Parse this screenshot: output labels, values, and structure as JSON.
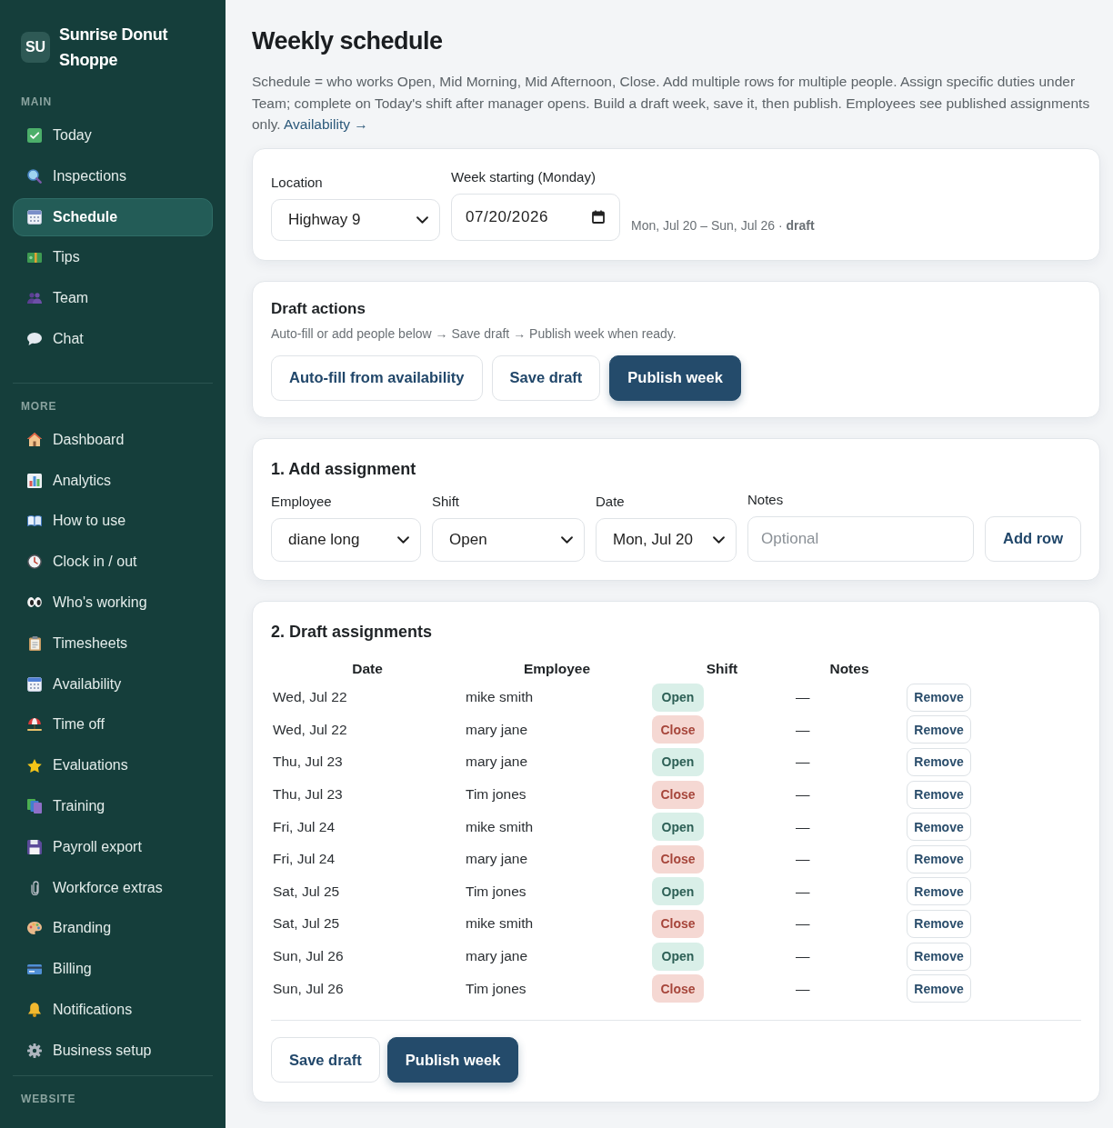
{
  "sidebar": {
    "logo": "SU",
    "brand": "Sunrise Donut Shoppe",
    "sections": [
      {
        "label": "MAIN",
        "items": [
          {
            "label": "Today",
            "selected": false
          },
          {
            "label": "Inspections",
            "selected": false
          },
          {
            "label": "Schedule",
            "selected": true
          },
          {
            "label": "Tips",
            "selected": false
          },
          {
            "label": "Team",
            "selected": false
          },
          {
            "label": "Chat",
            "selected": false
          }
        ]
      },
      {
        "label": "MORE",
        "items": [
          {
            "label": "Dashboard",
            "selected": false
          },
          {
            "label": "Analytics",
            "selected": false
          },
          {
            "label": "How to use",
            "selected": false
          },
          {
            "label": "Clock in / out",
            "selected": false
          },
          {
            "label": "Who's working",
            "selected": false
          },
          {
            "label": "Timesheets",
            "selected": false
          },
          {
            "label": "Availability",
            "selected": false
          },
          {
            "label": "Time off",
            "selected": false
          },
          {
            "label": "Evaluations",
            "selected": false
          },
          {
            "label": "Training",
            "selected": false
          },
          {
            "label": "Payroll export",
            "selected": false
          },
          {
            "label": "Workforce extras",
            "selected": false
          },
          {
            "label": "Branding",
            "selected": false
          },
          {
            "label": "Billing",
            "selected": false
          },
          {
            "label": "Notifications",
            "selected": false
          },
          {
            "label": "Business setup",
            "selected": false
          }
        ]
      },
      {
        "label": "WEBSITE"
      }
    ]
  },
  "page": {
    "title": "Weekly schedule",
    "description": "Schedule = who works Open, Mid Morning, Mid Afternoon, Close. Add multiple rows for multiple people. Assign specific duties under Team; complete on Today's shift after manager opens. Build a draft week, save it, then publish. Employees see published assignments only.",
    "link": "Availability →"
  },
  "week": {
    "location": {
      "label": "Location",
      "value": "Highway 9"
    },
    "week_start": {
      "label": "Week starting (Monday)",
      "value": "07/20/2026"
    },
    "summary": "Mon, Jul 20 – Sun, Jul 26 · **draft**"
  },
  "draft_actions": {
    "title": "Draft actions",
    "hint": "Auto-fill or add people below → Save draft → Publish week when ready.",
    "buttons": [
      {
        "label": "Auto-fill from availability",
        "kind": "secondary"
      },
      {
        "label": "Save draft",
        "kind": "secondary"
      },
      {
        "label": "Publish week",
        "kind": "primary"
      }
    ]
  },
  "add_assignment": {
    "title": "1. Add assignment",
    "fields": [
      {
        "label": "Employee",
        "kind": "select",
        "value": "diane long"
      },
      {
        "label": "Shift",
        "kind": "select",
        "value": "Open"
      },
      {
        "label": "Date",
        "kind": "select",
        "value": "Mon, Jul 20"
      },
      {
        "label": "Notes",
        "kind": "text",
        "placeholder": "Optional"
      }
    ],
    "button": "Add row"
  },
  "draft_assignments": {
    "title": "2. Draft assignments",
    "columns": [
      "Date",
      "Employee",
      "Shift",
      "Notes"
    ],
    "rows": [
      {
        "date": "Wed, Jul 22",
        "employee": "mike smith",
        "shift": "Open",
        "kind": "open",
        "notes": "—",
        "action": "Remove"
      },
      {
        "date": "Wed, Jul 22",
        "employee": "mary jane",
        "shift": "Close",
        "kind": "close",
        "notes": "—",
        "action": "Remove"
      },
      {
        "date": "Thu, Jul 23",
        "employee": "mary jane",
        "shift": "Open",
        "kind": "open",
        "notes": "—",
        "action": "Remove"
      },
      {
        "date": "Thu, Jul 23",
        "employee": "Tim jones",
        "shift": "Close",
        "kind": "close",
        "notes": "—",
        "action": "Remove"
      },
      {
        "date": "Fri, Jul 24",
        "employee": "mike smith",
        "shift": "Open",
        "kind": "open",
        "notes": "—",
        "action": "Remove"
      },
      {
        "date": "Fri, Jul 24",
        "employee": "mary jane",
        "shift": "Close",
        "kind": "close",
        "notes": "—",
        "action": "Remove"
      },
      {
        "date": "Sat, Jul 25",
        "employee": "Tim jones",
        "shift": "Open",
        "kind": "open",
        "notes": "—",
        "action": "Remove"
      },
      {
        "date": "Sat, Jul 25",
        "employee": "mike smith",
        "shift": "Close",
        "kind": "close",
        "notes": "—",
        "action": "Remove"
      },
      {
        "date": "Sun, Jul 26",
        "employee": "mary jane",
        "shift": "Open",
        "kind": "open",
        "notes": "—",
        "action": "Remove"
      },
      {
        "date": "Sun, Jul 26",
        "employee": "Tim jones",
        "shift": "Close",
        "kind": "close",
        "notes": "—",
        "action": "Remove"
      }
    ],
    "buttons": [
      {
        "label": "Save draft",
        "kind": "secondary"
      },
      {
        "label": "Publish week",
        "kind": "primary"
      }
    ]
  }
}
